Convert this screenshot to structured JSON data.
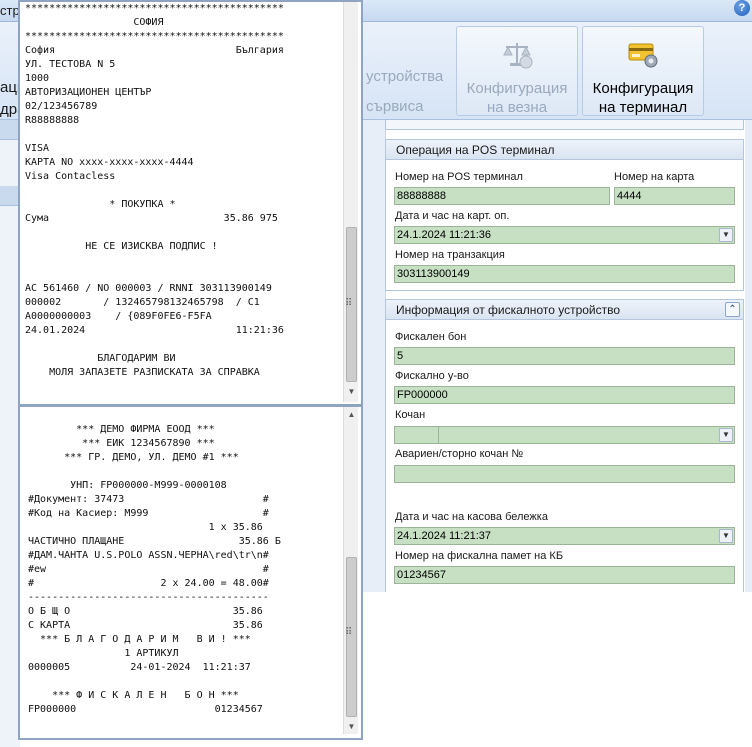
{
  "app": {
    "title_partial": "стр",
    "ribbon_left_lines": [
      "аци",
      "дра"
    ],
    "ribbon_partial_lines": [
      "устройства",
      "сървиса"
    ],
    "scale_button_label": [
      "Конфигурация",
      "на везна"
    ],
    "terminal_button_label": [
      "Конфигурация",
      "на терминал"
    ],
    "help_icon": "?"
  },
  "pos_group": {
    "title": "Операция на POS терминал",
    "terminal_label": "Номер на POS терминал",
    "terminal_value": "88888888",
    "card_label": "Номер на карта",
    "card_value": "4444",
    "datetime_label": "Дата и час на карт. оп.",
    "datetime_value": "24.1.2024 11:21:36",
    "transaction_label": "Номер на транзакция",
    "transaction_value": "303113900149"
  },
  "fiscal_group": {
    "title": "Информация от фискалното устройство",
    "bon_label": "Фискален бон",
    "bon_value": "5",
    "device_label": "Фискално у-во",
    "device_value": "FP000000",
    "kochan_label": "Кочан",
    "kochan_value": "",
    "storno_label": "Авариен/сторно кочан №",
    "storno_value": "",
    "receipt_dt_label": "Дата и час на касова бележка",
    "receipt_dt_value": "24.1.2024 11:21:37",
    "memory_label": "Номер на фискална памет на КБ",
    "memory_value": "01234567"
  },
  "card_receipt": {
    "lines": [
      "*******************************************",
      "                  СОФИЯ",
      "*******************************************",
      "София                              България",
      "УЛ. ТЕСТОВА N 5",
      "1000",
      "АВТОРИЗАЦИОНЕН ЦЕНТЪР",
      "02/123456789",
      "R88888888",
      "",
      "VISA",
      "КАРТА NO xxxx-xxxx-xxxx-4444",
      "Visa Contacless",
      "",
      "              * ПОКУПКА *",
      "Сума                             35.86 975",
      "",
      "          НЕ СЕ ИЗИСКВА ПОДПИС !",
      "",
      "",
      "AC 561460 / NO 000003 / RNNI 303113900149",
      "000002       / 132465798132465798  / C1",
      "A0000000003    / {089F0FE6-F5FA",
      "24.01.2024                         11:21:36",
      "",
      "            БЛАГОДАРИМ ВИ",
      "    МОЛЯ ЗАПАЗЕТЕ РАЗПИСКАТА ЗА СПРАВКА"
    ]
  },
  "fiscal_receipt": {
    "lines": [
      "",
      "        *** ДЕМО ФИРМА ЕООД ***",
      "         *** ЕИК 1234567890 ***",
      "      *** ГР. ДЕМО, УЛ. ДЕМО #1 ***",
      "",
      "       УНП: FP000000-M999-0000108",
      "#Документ: 37473                       #",
      "#Код на Касиер: M999                   #",
      "                              1 x 35.86",
      "ЧАСТИЧНО ПЛАЩАНЕ                   35.86 Б",
      "#ДАМ.ЧАНТА U.S.POLO ASSN.ЧЕРНА\\red\\tr\\n#",
      "#ew                                    #",
      "#                     2 x 24.00 = 48.00#",
      "----------------------------------------",
      "О Б Щ О                           35.86",
      "С КАРТА                           35.86",
      "  *** Б Л А Г О Д А Р И М   В И ! ***",
      "                1 АРТИКУЛ",
      "0000005          24-01-2024  11:21:37",
      "",
      "    *** Ф И С К А Л Е Н   Б О Н ***",
      "FP000000                       01234567"
    ]
  },
  "scrollbar": {
    "up": "▲",
    "down": "▼",
    "grip": "⠿"
  }
}
